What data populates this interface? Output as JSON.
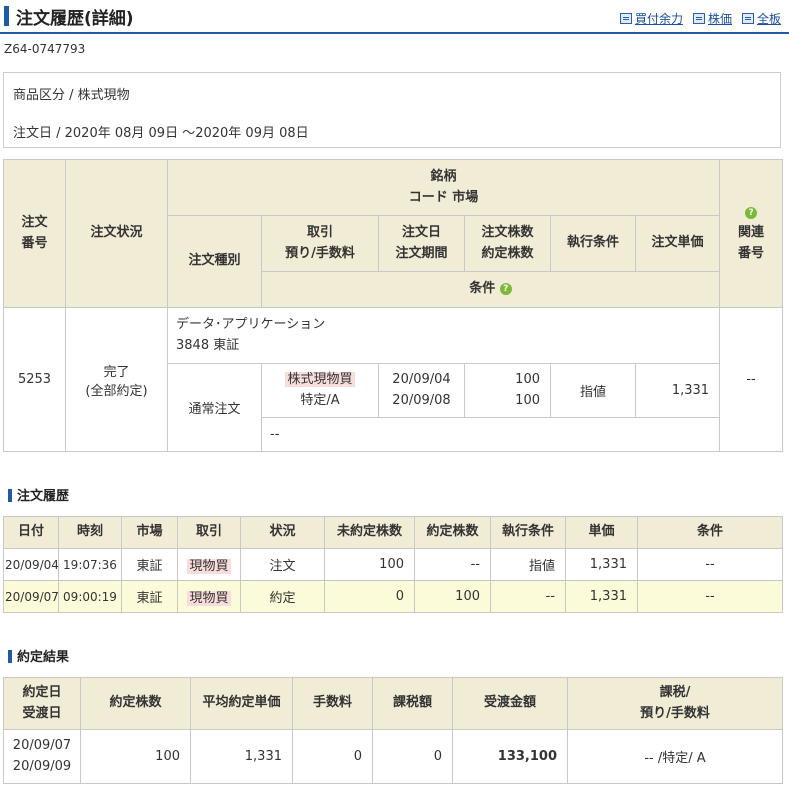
{
  "header": {
    "title": "注文履歴(詳細)",
    "links": [
      "買付余力",
      "株価",
      "全板"
    ],
    "order_id": "Z64-0747793"
  },
  "info": {
    "category": "商品区分 / 株式現物",
    "date_range": "注文日 /  2020年 08月 09日 ～2020年 09月 08日"
  },
  "main_table": {
    "h_order_no": "注文\n番号",
    "h_status": "注文状況",
    "h_brand": "銘柄\nコード  市場",
    "h_order_type": "注文種別",
    "h_trade": "取引\n預り/手数料",
    "h_order_date": "注文日\n注文期間",
    "h_qty": "注文株数\n約定株数",
    "h_exec": "執行条件",
    "h_price": "注文単価",
    "h_cond": "条件",
    "h_related": "関連\n番号",
    "row": {
      "order_no": "5253",
      "status": "完了\n(全部約定)",
      "brand_name": "データ･アプリケーション",
      "brand_code": "3848  東証",
      "order_type": "通常注文",
      "trade": "株式現物買",
      "account": "特定/A",
      "order_date": "20/09/04",
      "period": "20/09/08",
      "qty": "100",
      "filled": "100",
      "exec": "指値",
      "price": "1,331",
      "related": "--",
      "cond": "--"
    }
  },
  "history": {
    "title": "注文履歴",
    "headers": [
      "日付",
      "時刻",
      "市場",
      "取引",
      "状況",
      "未約定株数",
      "約定株数",
      "執行条件",
      "単価",
      "条件"
    ],
    "rows": [
      [
        "20/09/04",
        "19:07:36",
        "東証",
        "現物買",
        "注文",
        "100",
        "--",
        "指値",
        "1,331",
        "--"
      ],
      [
        "20/09/07",
        "09:00:19",
        "東証",
        "現物買",
        "約定",
        "0",
        "100",
        "--",
        "1,331",
        "--"
      ]
    ]
  },
  "results": {
    "title": "約定結果",
    "headers": [
      "約定日\n受渡日",
      "約定株数",
      "平均約定単価",
      "手数料",
      "課税額",
      "受渡金額",
      "課税/\n預り/手数料"
    ],
    "row": {
      "dates": "20/09/07\n20/09/09",
      "qty": "100",
      "avg_price": "1,331",
      "fee": "0",
      "tax": "0",
      "amount": "133,100",
      "tax_account": "-- /特定/ A"
    }
  }
}
